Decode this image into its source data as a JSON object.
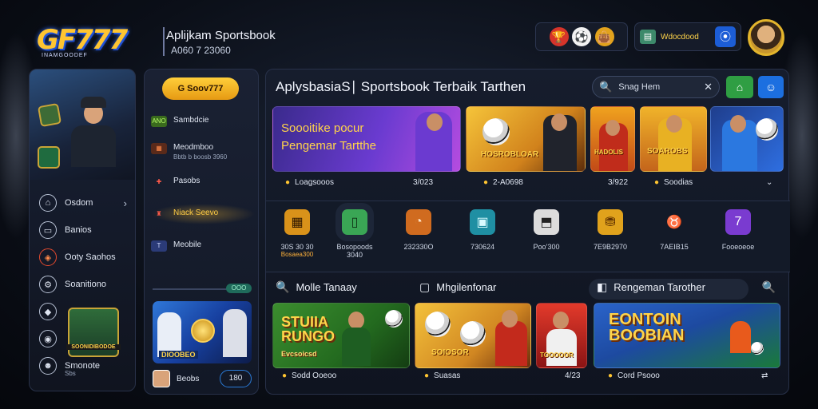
{
  "brand": {
    "logo_text": "GF777",
    "logo_sub": "INAMGOODEF",
    "app_title": "Aplijkam Sportsbook",
    "app_sub": "A060 7 23060"
  },
  "top_icons": [
    {
      "name": "trophy-icon",
      "glyph": "🏆"
    },
    {
      "name": "bag-icon",
      "glyph": "👜"
    },
    {
      "name": "soccer-ball-icon",
      "glyph": "⚽"
    }
  ],
  "promo": {
    "label": "Wdocdood",
    "box_glyph": "▤",
    "btn_glyph": "⦿"
  },
  "left_nav": {
    "items": [
      {
        "label": "Osdom",
        "icon": "⌂",
        "chevron": "›",
        "red": false
      },
      {
        "label": "Banios",
        "icon": "▭",
        "red": false
      },
      {
        "label": "Ooty Saohos",
        "icon": "◈",
        "red": true
      },
      {
        "label": "Soanitiono",
        "icon": "⚙",
        "red": false
      },
      {
        "label": "",
        "icon": "◆",
        "red": false
      },
      {
        "label": "",
        "icon": "◉",
        "red": false
      },
      {
        "label": "Smonote",
        "icon": "☻",
        "red": false,
        "sub": "Sbs"
      }
    ],
    "card_caption": "SOONIDIBODOE"
  },
  "mid_bar": {
    "pill": "G Soov777",
    "items": [
      {
        "icon": "ANO",
        "label": "Sambdcie",
        "sub": "",
        "icon_bg": "#3a6b1d",
        "icon_color": "#b9ff6a"
      },
      {
        "icon": "▦",
        "label": "Meodmboo",
        "sub": "Bbtb b boosb 3960",
        "icon_bg": "#5a2a1a",
        "icon_color": "#ff8a4a"
      },
      {
        "icon": "✚",
        "label": "Pasobs",
        "sub": "",
        "icon_bg": "transparent",
        "icon_color": "#ff5a4a"
      },
      {
        "icon": "♜",
        "label": "Niack Seevo",
        "sub": "",
        "icon_bg": "transparent",
        "icon_color": "#ff5a4a",
        "active": true
      },
      {
        "icon": "T",
        "label": "Meobile",
        "sub": "",
        "icon_bg": "#2b3b78",
        "icon_color": "#cfd9ff"
      }
    ],
    "tag": "OOO",
    "banner_caption": "DIOOBEO",
    "foot_label": "Beobs",
    "foot_badge": "180"
  },
  "main": {
    "title": "AplysbasiaS∣ Sportsbook Terbaik Tarthen",
    "search_placeholder": "Snag Hem",
    "hero": {
      "line1": "Soooitike pocur",
      "line2": "Pengemar Tartthe"
    },
    "row1_caps": {
      "c2": "HOSROBLOAR",
      "c3": "HADOLIS",
      "c4": "SOAROBS",
      "c5": ""
    },
    "row1_foot": [
      {
        "text": "Loagsooos"
      },
      {
        "text": "3/023",
        "plain": true
      },
      {
        "text": "2-A0698"
      },
      {
        "text": "3/922",
        "plain": true
      },
      {
        "text": "Soodias"
      }
    ],
    "row1_chevron": "⌄",
    "categories": [
      {
        "icon": "▦",
        "label": "30S 30 30",
        "sub": "Bosaea300",
        "bg": "#d9921a",
        "color": "#2b1500"
      },
      {
        "icon": "▯",
        "label": "Bosopoods",
        "sub": "",
        "label2": "3040",
        "bg": "#3aa655",
        "color": "#0d2d13",
        "selected": true
      },
      {
        "icon": "◔",
        "label": "232330O",
        "sub": "",
        "bg": "#d06b1f",
        "color": "#ffe1c2"
      },
      {
        "icon": "▣",
        "label": "730624",
        "sub": "",
        "bg": "#1f8fa3",
        "color": "#d9fbff"
      },
      {
        "icon": "⬒",
        "label": "Poo’300",
        "sub": "",
        "bg": "#dcdcdc",
        "color": "#222"
      },
      {
        "icon": "⛃",
        "label": "7E9B2970",
        "sub": "",
        "bg": "#e0a21c",
        "color": "#5a2d00"
      },
      {
        "icon": "♉",
        "label": "7AEIB15",
        "sub": "",
        "bg": "transparent",
        "color": "#a9b7ff"
      },
      {
        "icon": "7",
        "label": "Fooeoeoe",
        "sub": "",
        "bg": "#7a3bd0",
        "color": "#fff"
      }
    ],
    "row3_heads": [
      {
        "icon": "🔍",
        "label": "Molle Tanaay"
      },
      {
        "icon": "▢",
        "label": "Mhgilenfonar"
      },
      {
        "icon": "◧",
        "label": "Rengeman Tarother"
      }
    ],
    "row3_caps": {
      "g1a": "STUIIA",
      "g1b": "RUNGO",
      "g1c": "Evcsoicsd",
      "g2": "SOIOSOR",
      "g3": "TOOOOOR",
      "g4a": "EONTOIN",
      "g4b": "BOOBIAN"
    },
    "row3_foot": [
      {
        "text": "Sodd Ooeoo"
      },
      {
        "text": "Suasas"
      },
      {
        "text": "4/23",
        "plain": true
      },
      {
        "text": "Cord Psooo"
      }
    ]
  }
}
